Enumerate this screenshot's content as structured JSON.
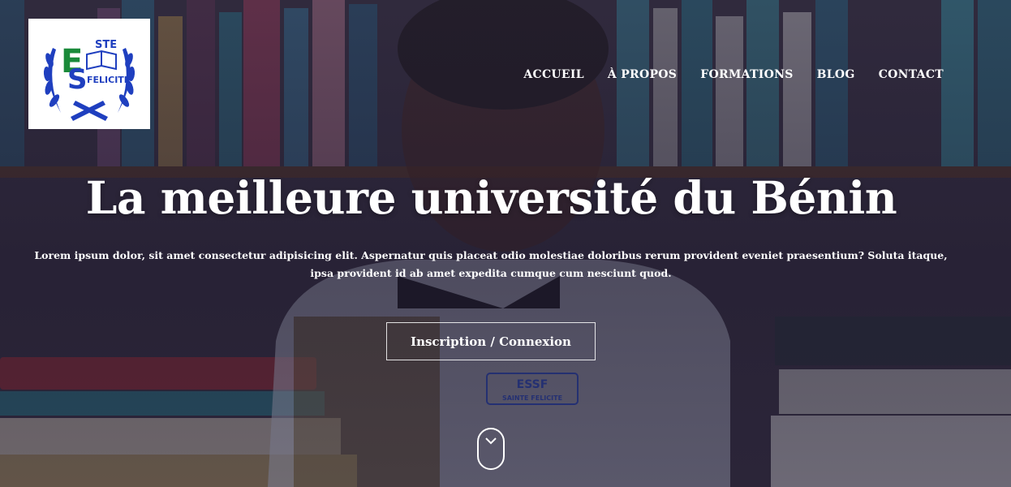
{
  "brand": {
    "logo_top": "STE",
    "logo_bottom": "FELICITE",
    "logo_initials": "ESF",
    "colors": {
      "primary": "#1f3fbf",
      "accent": "#1a8a3a"
    }
  },
  "nav": {
    "items": [
      {
        "label": "ACCUEIL"
      },
      {
        "label": "À PROPOS"
      },
      {
        "label": "FORMATIONS"
      },
      {
        "label": "BLOG"
      },
      {
        "label": "CONTACT"
      }
    ]
  },
  "hero": {
    "title": "La meilleure université du Bénin",
    "subtitle": "Lorem ipsum dolor, sit amet consectetur adipisicing elit. Aspernatur quis placeat odio molestiae doloribus rerum provident eveniet praesentium? Soluta itaque, ipsa provident id ab amet expedita cumque cum nesciunt quod.",
    "cta_label": "Inscription / Connexion",
    "scroll_icon": "chevron-down-icon",
    "badge_text_top": "ESSF",
    "badge_text_bottom": "SAINTE FELICITE"
  }
}
